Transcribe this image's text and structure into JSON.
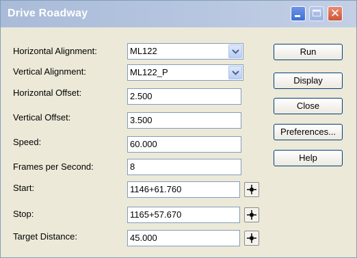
{
  "window": {
    "title": "Drive Roadway"
  },
  "icons": {
    "minimize": "minimize-icon",
    "maximize": "maximize-icon",
    "close": "close-icon",
    "dropdown": "chevron-down-icon",
    "pick": "crosshair-icon"
  },
  "form": {
    "horizontal_alignment": {
      "label": "Horizontal Alignment:",
      "value": "ML122"
    },
    "vertical_alignment": {
      "label": "Vertical Alignment:",
      "value": "ML122_P"
    },
    "horizontal_offset": {
      "label": "Horizontal Offset:",
      "value": "2.500"
    },
    "vertical_offset": {
      "label": "Vertical Offset:",
      "value": "3.500"
    },
    "speed": {
      "label": "Speed:",
      "value": "60.000"
    },
    "frames_per_second": {
      "label": "Frames per Second:",
      "value": "8"
    },
    "start": {
      "label": "Start:",
      "value": "1146+61.760"
    },
    "stop": {
      "label": "Stop:",
      "value": "1165+57.670"
    },
    "target_distance": {
      "label": "Target Distance:",
      "value": "45.000"
    }
  },
  "buttons": {
    "run": "Run",
    "display": "Display",
    "close": "Close",
    "preferences": "Preferences...",
    "help": "Help"
  },
  "colors": {
    "titlebar": "#b5c5df",
    "window_bg": "#ece9d8",
    "field_border": "#7f9db9",
    "button_border": "#003c74"
  }
}
